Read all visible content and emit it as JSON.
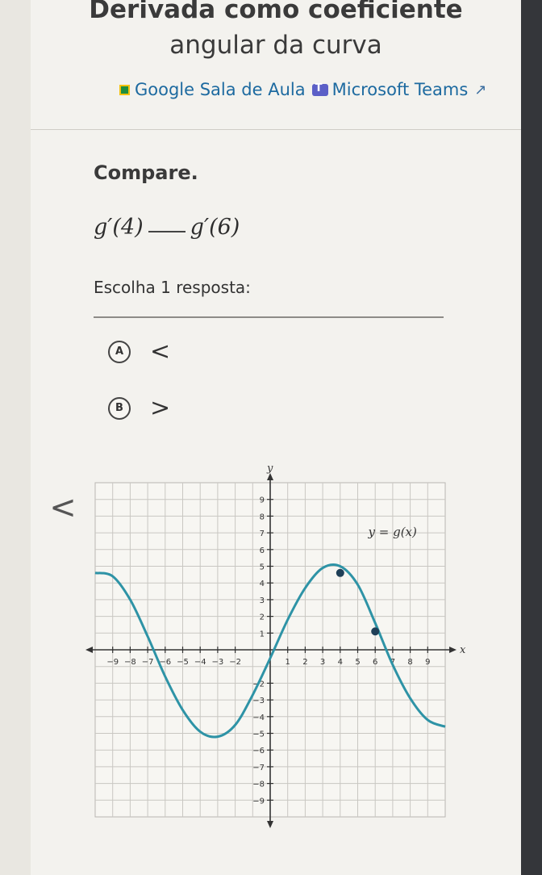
{
  "page": {
    "title_line1": "Derivada como coeficiente",
    "title_line2": "angular da curva"
  },
  "share": {
    "classroom_label": "Google Sala de Aula",
    "teams_label": "Microsoft Teams",
    "classroom_icon": "google-classroom-icon",
    "teams_icon": "microsoft-teams-icon",
    "external_icon": "external-link-icon"
  },
  "question": {
    "prompt": "Compare.",
    "left_expr": "g′(4)",
    "right_expr": "g′(6)",
    "choose_label": "Escolha 1 resposta:"
  },
  "choices": [
    {
      "letter": "A",
      "symbol": "<"
    },
    {
      "letter": "B",
      "symbol": ">"
    }
  ],
  "nav": {
    "prev_symbol": "<"
  },
  "chart_data": {
    "type": "line",
    "xlim": [
      -10,
      10
    ],
    "ylim": [
      -10,
      10
    ],
    "x_axis_label": "x",
    "y_axis_label": "y",
    "x_ticks": [
      -9,
      -8,
      -7,
      -6,
      -5,
      -4,
      -3,
      -2,
      1,
      2,
      3,
      4,
      5,
      6,
      7,
      8,
      9
    ],
    "x_tick_labels": [
      "−9",
      "−8",
      "−7",
      "−6",
      "−5",
      "−4",
      "−3",
      "−2",
      "1",
      "2",
      "3",
      "4",
      "5",
      "6",
      "7",
      "8",
      "9"
    ],
    "y_ticks": [
      -9,
      -8,
      -7,
      -6,
      -5,
      -4,
      -3,
      -2,
      1,
      2,
      3,
      4,
      5,
      6,
      7,
      8,
      9
    ],
    "y_tick_labels": [
      "−9",
      "−8",
      "−7",
      "−6",
      "−5",
      "−4",
      "−3",
      "−2",
      "1",
      "2",
      "3",
      "4",
      "5",
      "6",
      "7",
      "8",
      "9"
    ],
    "grid": true,
    "curve_label": "y = g(x)",
    "curve_color": "#2e93a6",
    "point_color": "#1f3f57",
    "series": [
      {
        "x": [
          -10,
          -9,
          -8,
          -7,
          -6,
          -5,
          -4,
          -3,
          -2,
          -1,
          0,
          1,
          2,
          3,
          4,
          5,
          6,
          7,
          8,
          9,
          10
        ],
        "y": [
          4.6,
          4.4,
          3.0,
          0.8,
          -1.6,
          -3.6,
          -4.9,
          -5.2,
          -4.5,
          -2.7,
          -0.5,
          1.8,
          3.7,
          4.9,
          5.0,
          3.9,
          1.6,
          -0.9,
          -2.9,
          -4.2,
          -4.6
        ]
      }
    ],
    "highlighted_points": [
      {
        "x": 4,
        "y": 4.6
      },
      {
        "x": 6,
        "y": 1.1
      }
    ]
  }
}
